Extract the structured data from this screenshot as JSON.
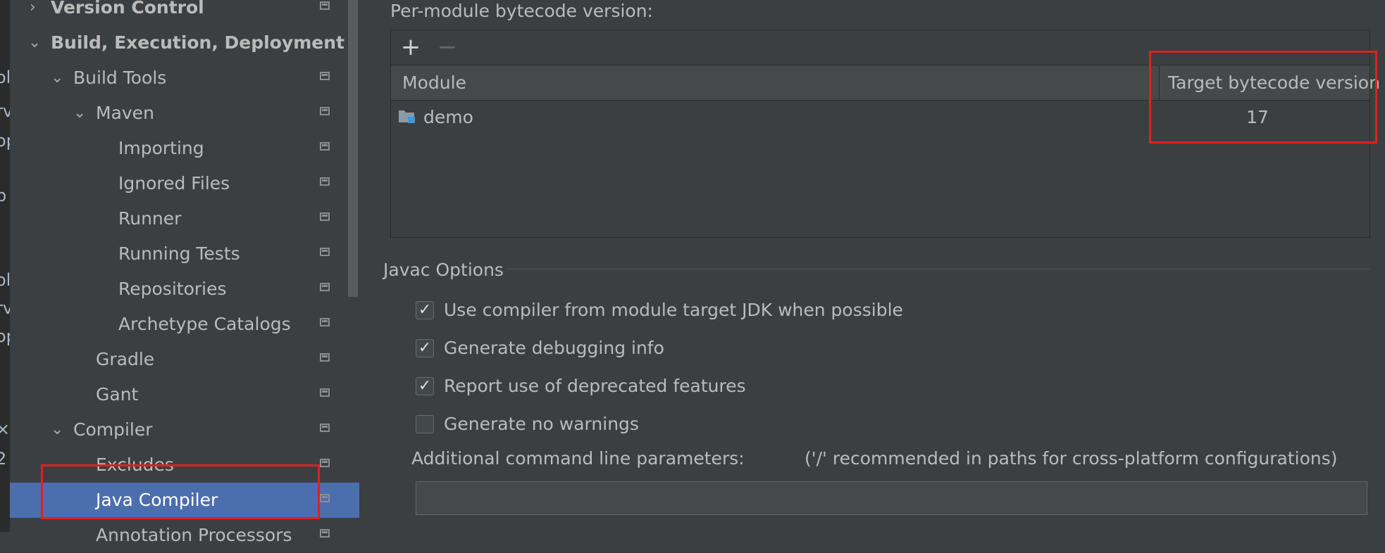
{
  "edge_fragments": [
    "ole",
    "rv",
    "op",
    "p",
    "ole",
    "rv",
    "op",
    "×",
    "2"
  ],
  "sidebar": {
    "items": [
      {
        "label": "Version Control",
        "expanded": false,
        "bold": true
      },
      {
        "label": "Build, Execution, Deployment",
        "expanded": true,
        "bold": true
      },
      {
        "label": "Build Tools",
        "expanded": true
      },
      {
        "label": "Maven",
        "expanded": true
      },
      {
        "label": "Importing"
      },
      {
        "label": "Ignored Files"
      },
      {
        "label": "Runner"
      },
      {
        "label": "Running Tests"
      },
      {
        "label": "Repositories"
      },
      {
        "label": "Archetype Catalogs"
      },
      {
        "label": "Gradle"
      },
      {
        "label": "Gant"
      },
      {
        "label": "Compiler",
        "expanded": true
      },
      {
        "label": "Excludes"
      },
      {
        "label": "Java Compiler",
        "selected": true
      },
      {
        "label": "Annotation Processors"
      }
    ]
  },
  "bytecode": {
    "title": "Per-module bytecode version:",
    "add_label": "+",
    "remove_label": "−",
    "columns": {
      "module": "Module",
      "target": "Target bytecode version"
    },
    "rows": [
      {
        "module": "demo",
        "target": "17"
      }
    ]
  },
  "javac": {
    "title": "Javac Options",
    "options": [
      {
        "label": "Use compiler from module target JDK when possible",
        "checked": true
      },
      {
        "label": "Generate debugging info",
        "checked": true
      },
      {
        "label": "Report use of deprecated features",
        "checked": true
      },
      {
        "label": "Generate no warnings",
        "checked": false
      }
    ],
    "params_label": "Additional command line parameters:",
    "params_hint": "('/' recommended in paths for cross-platform configurations)",
    "params_value": ""
  },
  "colors": {
    "selection": "#4b6eaf",
    "highlight": "#e02020",
    "background": "#3c3f41"
  },
  "icons": {
    "folder": "module-folder-icon",
    "expand": "expand-icon",
    "project": "project-level-icon"
  }
}
